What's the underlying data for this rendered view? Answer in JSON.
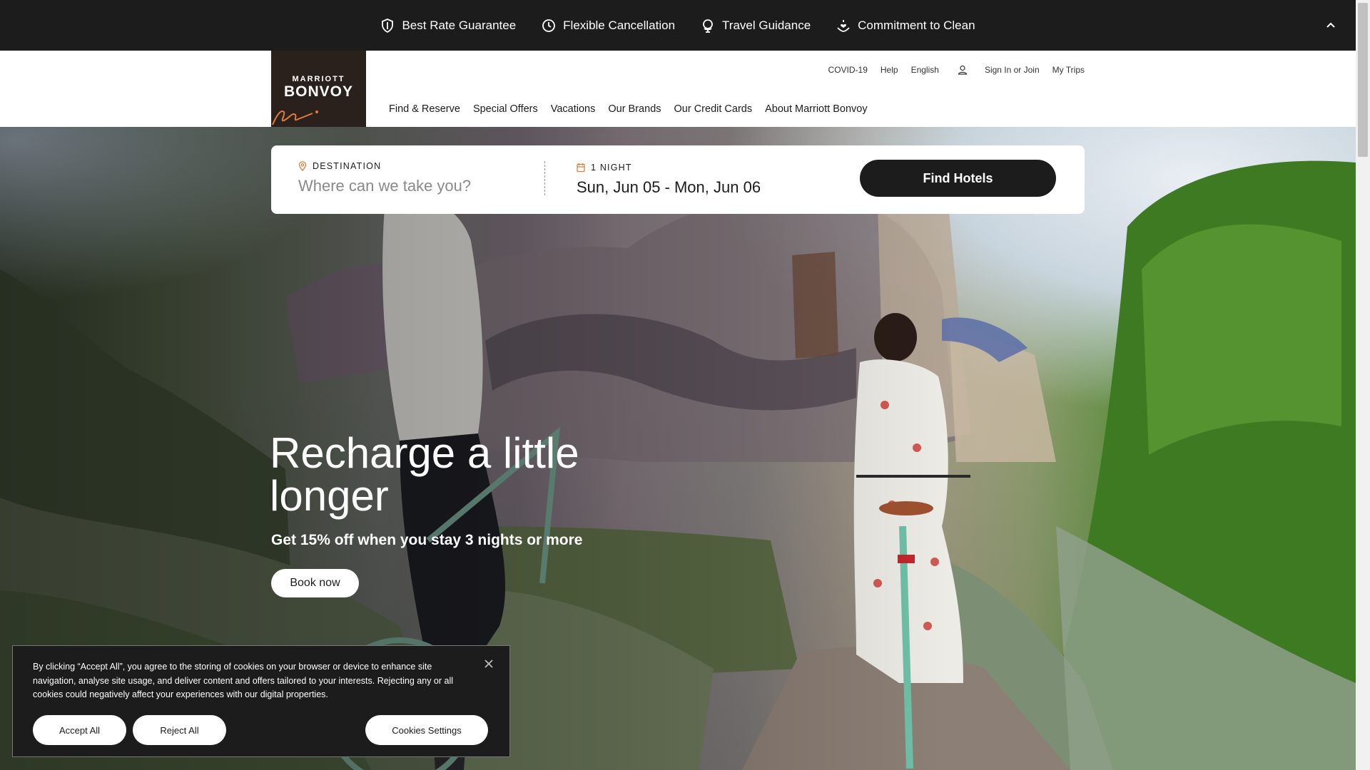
{
  "promo": {
    "items": [
      {
        "label": "Best Rate Guarantee",
        "icon": "shield-icon"
      },
      {
        "label": "Flexible Cancellation",
        "icon": "clock-icon"
      },
      {
        "label": "Travel Guidance",
        "icon": "globe-icon"
      },
      {
        "label": "Commitment to Clean",
        "icon": "hand-heart-icon"
      }
    ],
    "collapse_icon": "chevron-up-icon"
  },
  "header": {
    "logo_top": "MARRIOTT",
    "logo_main": "BONVOY",
    "util": {
      "covid": "COVID-19",
      "help": "Help",
      "language": "English",
      "signin": "Sign In or Join",
      "trips": "My Trips"
    },
    "nav": [
      "Find & Reserve",
      "Special Offers",
      "Vacations",
      "Our Brands",
      "Our Credit Cards",
      "About Marriott Bonvoy"
    ]
  },
  "search": {
    "destination_label": "DESTINATION",
    "destination_placeholder": "Where can we take you?",
    "nights_label": "1 NIGHT",
    "dates": "Sun, Jun 05 - Mon, Jun 06",
    "find_button": "Find Hotels"
  },
  "hero": {
    "title": "Recharge a little longer",
    "subtitle": "Get 15% off when you stay 3 nights or more",
    "cta": "Book now"
  },
  "cookie": {
    "text": "By clicking “Accept All”, you agree to the storing of cookies on your browser or device to enhance site navigation, analyse site usage, and deliver content and offers tailored to your interests. Rejecting any or all cookies could negatively affect your experiences with our digital properties.",
    "accept": "Accept All",
    "reject": "Reject All",
    "settings": "Cookies Settings"
  },
  "colors": {
    "dark": "#1c1c1c",
    "accent_orange": "#e07b39",
    "logo_bg": "#2a211d"
  }
}
